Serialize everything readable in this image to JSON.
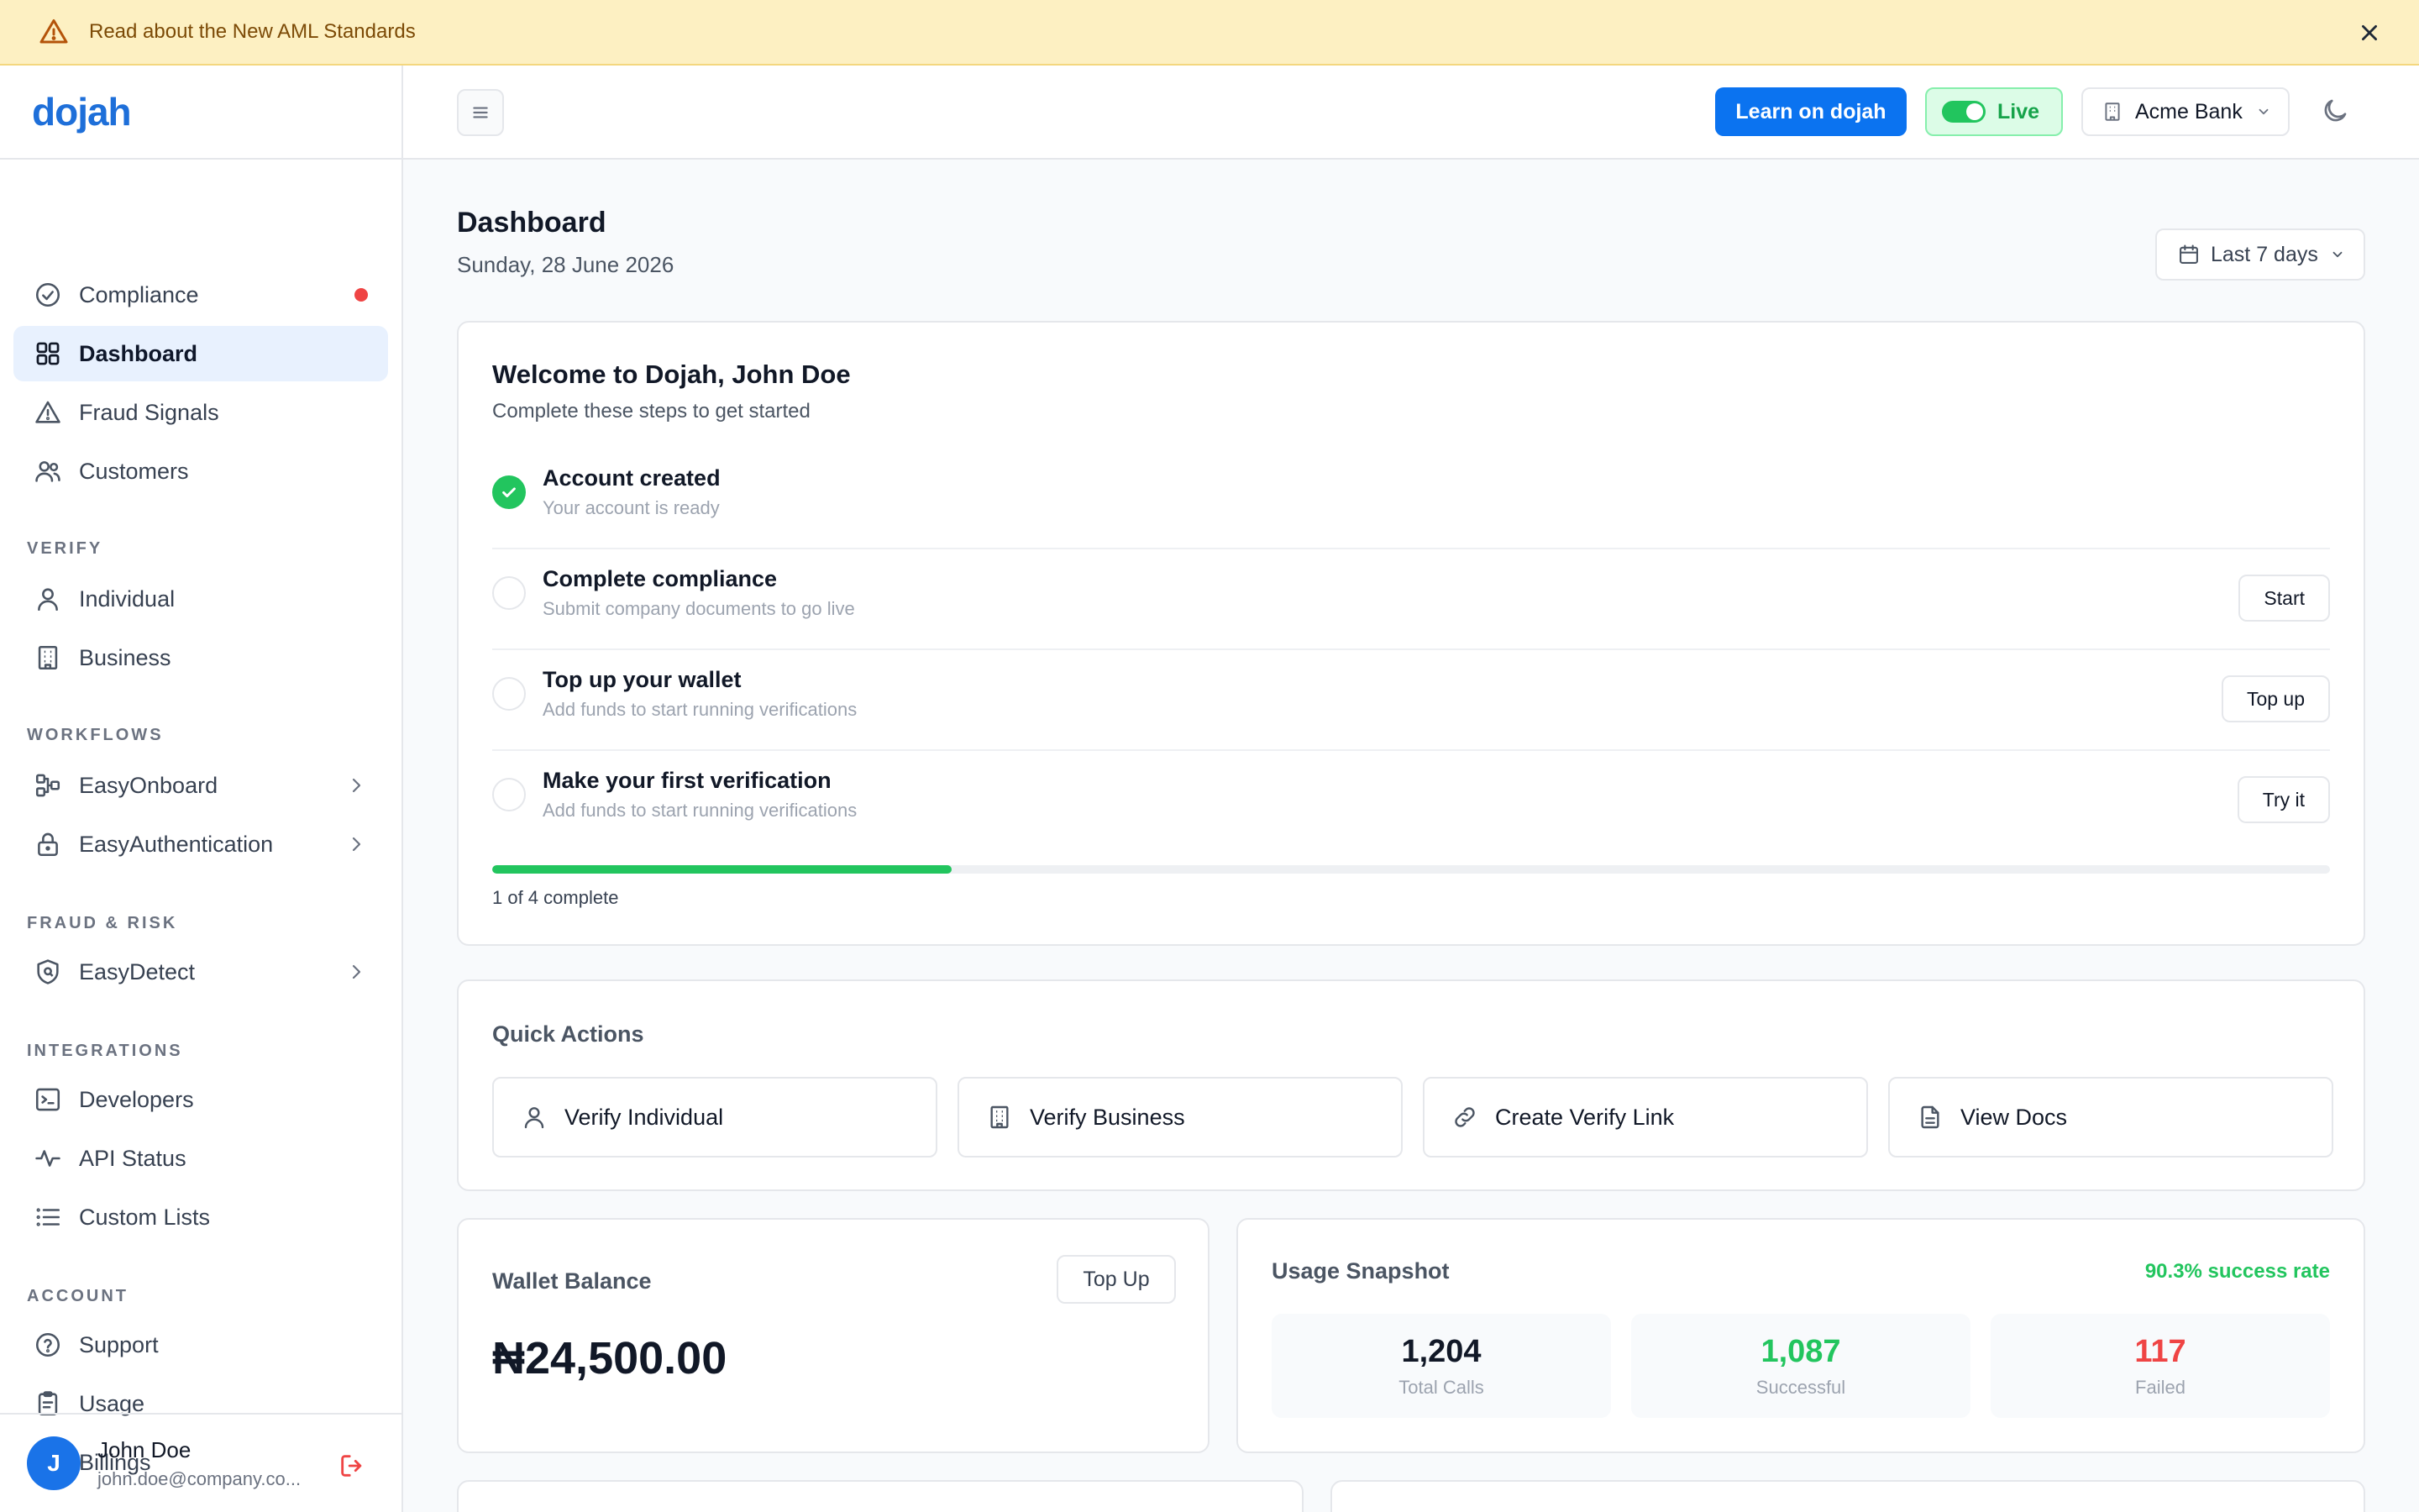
{
  "banner": {
    "text": "Read about the New AML Standards"
  },
  "brand": {
    "name": "dojah"
  },
  "sidebar": {
    "top_items": [
      {
        "label": "Compliance"
      },
      {
        "label": "Dashboard"
      },
      {
        "label": "Fraud Signals"
      },
      {
        "label": "Customers"
      }
    ],
    "sections": {
      "verify": "VERIFY",
      "workflows": "WORKFLOWS",
      "fraud_risk": "FRAUD & RISK",
      "integrations": "INTEGRATIONS",
      "account": "ACCOUNT"
    },
    "verify_items": [
      {
        "label": "Individual"
      },
      {
        "label": "Business"
      }
    ],
    "workflow_items": [
      {
        "label": "EasyOnboard"
      },
      {
        "label": "EasyAuthentication"
      }
    ],
    "fraud_items": [
      {
        "label": "EasyDetect"
      }
    ],
    "integration_items": [
      {
        "label": "Developers"
      },
      {
        "label": "API Status"
      },
      {
        "label": "Custom Lists"
      }
    ],
    "account_items": [
      {
        "label": "Support"
      },
      {
        "label": "Usage"
      },
      {
        "label": "Billings"
      }
    ]
  },
  "user": {
    "initial": "J",
    "name": "John Doe",
    "email": "john.doe@company.co..."
  },
  "topbar": {
    "learn_label": "Learn on dojah",
    "live_label": "Live",
    "org_name": "Acme Bank"
  },
  "page": {
    "title": "Dashboard",
    "date": "Sunday, 28 June 2026",
    "range_label": "Last 7 days"
  },
  "welcome": {
    "title": "Welcome to Dojah, John Doe",
    "subtitle": "Complete these steps to get started",
    "steps": [
      {
        "title": "Account created",
        "desc": "Your account is ready",
        "done": true
      },
      {
        "title": "Complete compliance",
        "desc": "Submit company documents to go live",
        "button": "Start"
      },
      {
        "title": "Top up your wallet",
        "desc": "Add funds to start running verifications",
        "button": "Top up"
      },
      {
        "title": "Make your first verification",
        "desc": "Add funds to start running verifications",
        "button": "Try it"
      }
    ],
    "progress_fraction": 0.25,
    "progress_label": "1 of 4 complete"
  },
  "quick_actions": {
    "title": "Quick Actions",
    "items": [
      {
        "label": "Verify Individual"
      },
      {
        "label": "Verify Business"
      },
      {
        "label": "Create Verify Link"
      },
      {
        "label": "View Docs"
      }
    ]
  },
  "wallet": {
    "title": "Wallet Balance",
    "topup_label": "Top Up",
    "amount": "₦24,500.00"
  },
  "usage": {
    "title": "Usage Snapshot",
    "success_rate": "90.3% success rate",
    "stats": [
      {
        "value": "1,204",
        "label": "Total Calls",
        "color": "#111827"
      },
      {
        "value": "1,087",
        "label": "Successful",
        "color": "#22c55e"
      },
      {
        "value": "117",
        "label": "Failed",
        "color": "#ef4444"
      }
    ]
  },
  "colors": {
    "accent": "#0b73f0",
    "success": "#22c55e",
    "danger": "#ef4444",
    "banner_bg": "#fdf0c2"
  }
}
